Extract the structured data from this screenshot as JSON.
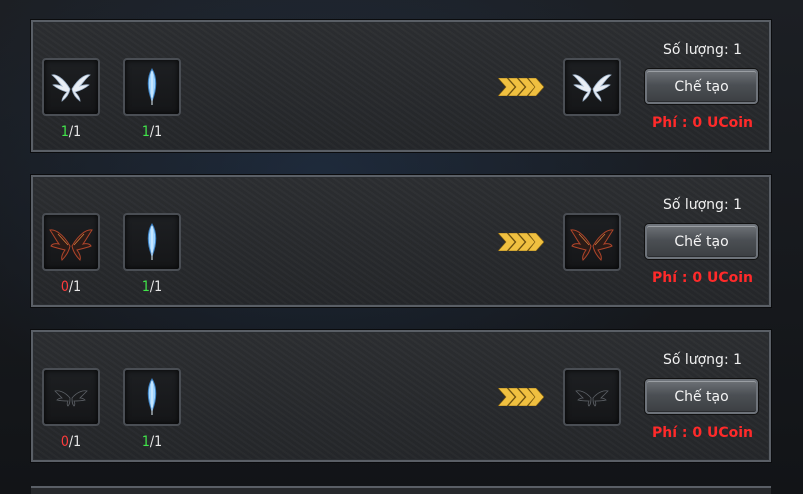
{
  "recipes": [
    {
      "materials": [
        {
          "icon": "white-wings-icon",
          "have": "1",
          "need": "/1",
          "status": "ok"
        },
        {
          "icon": "blue-feather-icon",
          "have": "1",
          "need": "/1",
          "status": "ok"
        }
      ],
      "result_icon": "white-wings-icon",
      "quantity_label": "Số lượng: 1",
      "craft_label": "Chế tạo",
      "fee_label": "Phí : 0 UCoin"
    },
    {
      "materials": [
        {
          "icon": "dark-red-wings-icon",
          "have": "0",
          "need": "/1",
          "status": "no"
        },
        {
          "icon": "blue-feather-icon",
          "have": "1",
          "need": "/1",
          "status": "ok"
        }
      ],
      "result_icon": "dark-red-wings-icon",
      "quantity_label": "Số lượng: 1",
      "craft_label": "Chế tạo",
      "fee_label": "Phí : 0 UCoin"
    },
    {
      "materials": [
        {
          "icon": "small-dark-wings-icon",
          "have": "0",
          "need": "/1",
          "status": "no"
        },
        {
          "icon": "blue-feather-icon",
          "have": "1",
          "need": "/1",
          "status": "ok"
        }
      ],
      "result_icon": "small-dark-wings-icon",
      "quantity_label": "Số lượng: 1",
      "craft_label": "Chế tạo",
      "fee_label": "Phí : 0 UCoin"
    }
  ],
  "colors": {
    "have_ok": "#41e84a",
    "have_no": "#ff3b3b",
    "fee": "#ff2a2a",
    "arrow": "#f0c040"
  }
}
